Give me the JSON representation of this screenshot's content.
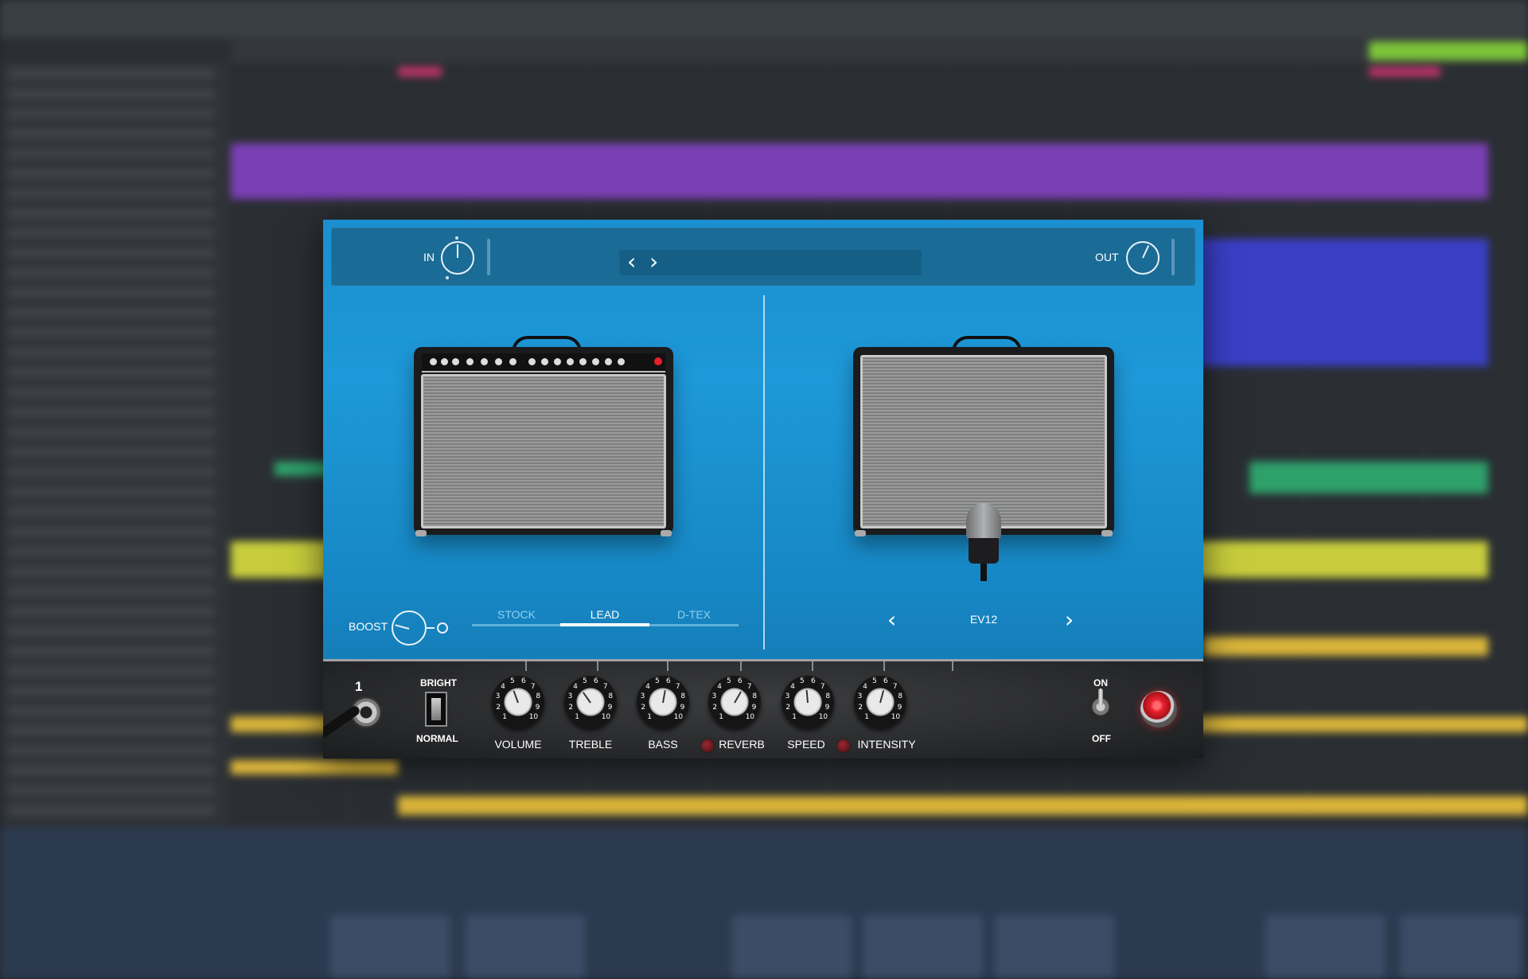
{
  "plugin": {
    "input_label": "IN",
    "output_label": "OUT",
    "preset_name": "",
    "boost_label": "BOOST",
    "tone_tabs": [
      {
        "label": "STOCK",
        "active": false
      },
      {
        "label": "LEAD",
        "active": true
      },
      {
        "label": "D-TEX",
        "active": false
      }
    ],
    "mic_name": "EV12",
    "channel_number": "1",
    "bright_label": "BRIGHT",
    "normal_label": "NORMAL",
    "knobs": [
      {
        "label": "VOLUME",
        "scale": [
          "1",
          "2",
          "3",
          "4",
          "5",
          "6",
          "7",
          "8",
          "9",
          "10"
        ]
      },
      {
        "label": "TREBLE",
        "scale": [
          "1",
          "2",
          "3",
          "4",
          "5",
          "6",
          "7",
          "8",
          "9",
          "10"
        ]
      },
      {
        "label": "BASS",
        "scale": [
          "1",
          "2",
          "3",
          "4",
          "5",
          "6",
          "7",
          "8",
          "9",
          "10"
        ]
      },
      {
        "label": "REVERB",
        "scale": [
          "1",
          "2",
          "3",
          "4",
          "5",
          "6",
          "7",
          "8",
          "9",
          "10"
        ]
      },
      {
        "label": "SPEED",
        "scale": [
          "1",
          "2",
          "3",
          "4",
          "5",
          "6",
          "7",
          "8",
          "9",
          "10"
        ]
      },
      {
        "label": "INTENSITY",
        "scale": [
          "1",
          "2",
          "3",
          "4",
          "5",
          "6",
          "7",
          "8",
          "9",
          "10"
        ]
      }
    ],
    "power_on_label": "ON",
    "power_off_label": "OFF",
    "colors": {
      "panel_blue": "#1b8fcf",
      "topbar_blue": "#1a6c96",
      "pilot_light": "#e8202c",
      "led_off": "#7a1a20"
    },
    "icons": {
      "prev": "chevron-left-icon",
      "next": "chevron-right-icon"
    }
  }
}
